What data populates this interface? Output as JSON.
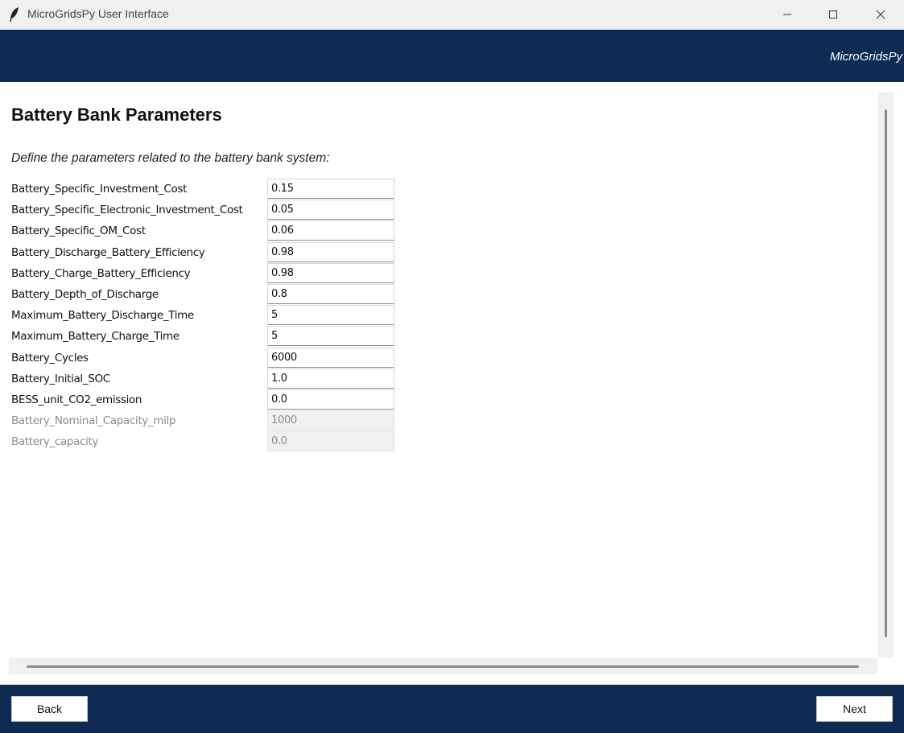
{
  "window": {
    "title": "MicroGridsPy User Interface",
    "icon": "feather-icon",
    "controls": [
      "minimize-icon",
      "maximize-icon",
      "close-icon"
    ]
  },
  "header": {
    "brand": "MicroGridsPy",
    "background_color": "#0e2c53"
  },
  "page": {
    "title": "Battery Bank Parameters",
    "subtitle": "Define the parameters related to the battery bank system:"
  },
  "parameters": [
    {
      "label": "Battery_Specific_Investment_Cost",
      "value": "0.15",
      "enabled": true
    },
    {
      "label": "Battery_Specific_Electronic_Investment_Cost",
      "value": "0.05",
      "enabled": true
    },
    {
      "label": "Battery_Specific_OM_Cost",
      "value": "0.06",
      "enabled": true
    },
    {
      "label": "Battery_Discharge_Battery_Efficiency",
      "value": "0.98",
      "enabled": true
    },
    {
      "label": "Battery_Charge_Battery_Efficiency",
      "value": "0.98",
      "enabled": true
    },
    {
      "label": "Battery_Depth_of_Discharge",
      "value": "0.8",
      "enabled": true
    },
    {
      "label": "Maximum_Battery_Discharge_Time",
      "value": "5",
      "enabled": true
    },
    {
      "label": "Maximum_Battery_Charge_Time",
      "value": "5",
      "enabled": true
    },
    {
      "label": "Battery_Cycles",
      "value": "6000",
      "enabled": true
    },
    {
      "label": "Battery_Initial_SOC",
      "value": "1.0",
      "enabled": true
    },
    {
      "label": "BESS_unit_CO2_emission",
      "value": "0.0",
      "enabled": true
    },
    {
      "label": "Battery_Nominal_Capacity_milp",
      "value": "1000",
      "enabled": false
    },
    {
      "label": "Battery_capacity",
      "value": "0.0",
      "enabled": false
    }
  ],
  "footer": {
    "back_label": "Back",
    "next_label": "Next"
  }
}
